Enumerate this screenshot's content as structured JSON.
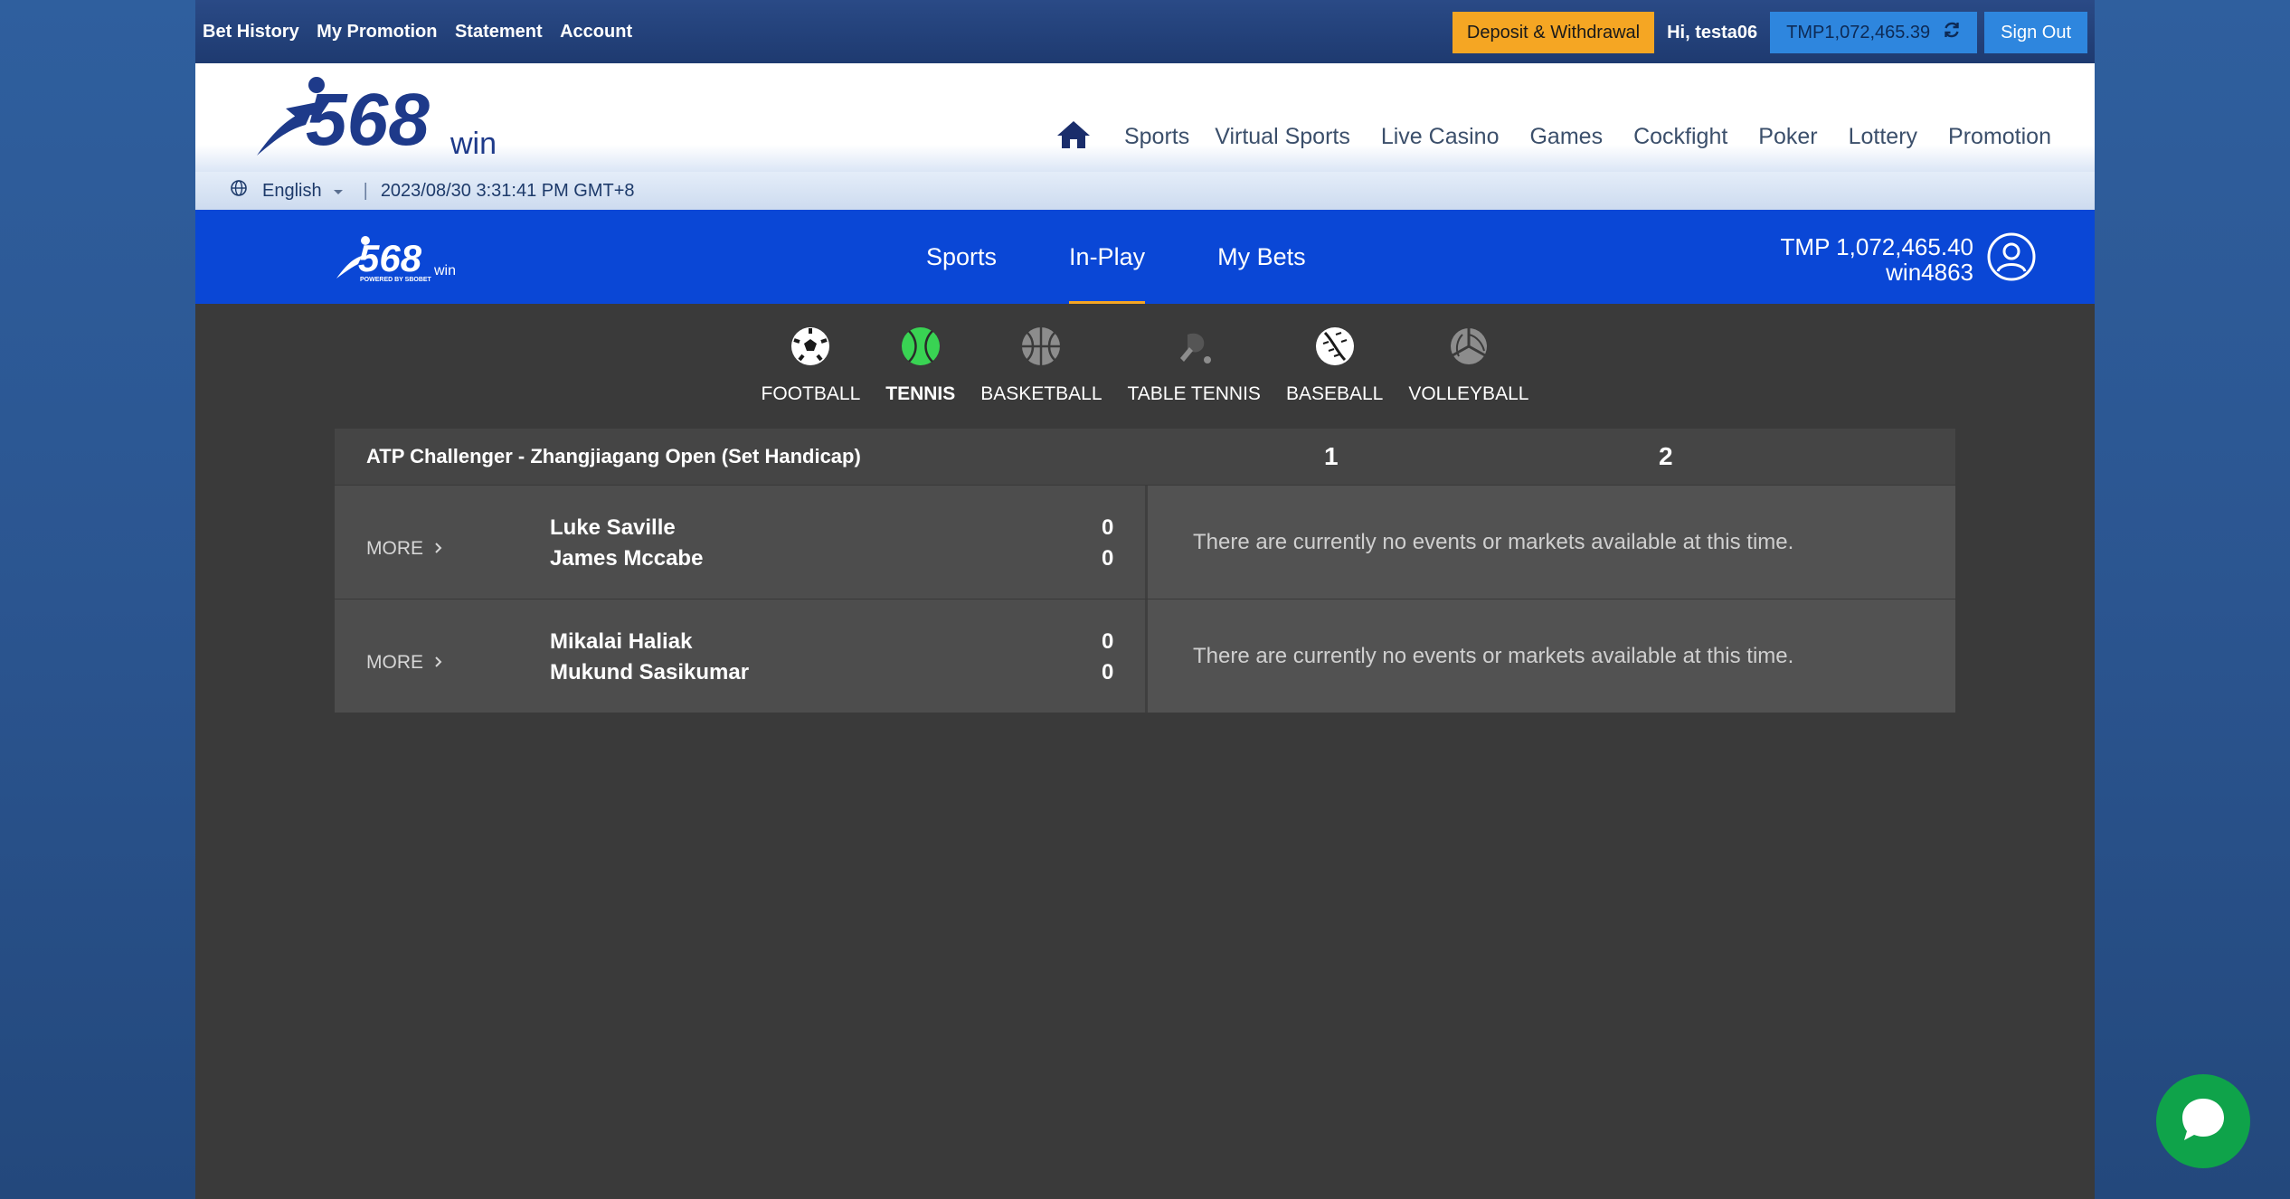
{
  "topbar": {
    "links": [
      "Bet History",
      "My Promotion",
      "Statement",
      "Account"
    ],
    "deposit_label": "Deposit & Withdrawal",
    "greeting": "Hi, testa06",
    "balance": "TMP1,072,465.39",
    "signout_label": "Sign Out"
  },
  "header": {
    "logo_text": "568",
    "logo_suffix": "win",
    "nav": [
      "Sports",
      "Virtual Sports",
      "Live Casino",
      "Games",
      "Cockfight",
      "Poker",
      "Lottery",
      "Promotion"
    ]
  },
  "subbar": {
    "language": "English",
    "datetime": "2023/08/30 3:31:41 PM GMT+8"
  },
  "sportsbook": {
    "logo_text": "568",
    "logo_suffix": "win",
    "logo_tagline": "POWERED BY SBOBET",
    "tabs": [
      "Sports",
      "In-Play",
      "My Bets"
    ],
    "active_tab": "In-Play",
    "balance": "TMP 1,072,465.40",
    "username": "win4863"
  },
  "sports": [
    {
      "label": "FOOTBALL",
      "icon": "football-icon"
    },
    {
      "label": "TENNIS",
      "icon": "tennis-icon"
    },
    {
      "label": "BASKETBALL",
      "icon": "basketball-icon"
    },
    {
      "label": "TABLE TENNIS",
      "icon": "table-tennis-icon"
    },
    {
      "label": "BASEBALL",
      "icon": "baseball-icon"
    },
    {
      "label": "VOLLEYBALL",
      "icon": "volleyball-icon"
    }
  ],
  "active_sport": "TENNIS",
  "league": {
    "name": "ATP Challenger - Zhangjiagang Open (Set Handicap)",
    "col1": "1",
    "col2": "2",
    "events": [
      {
        "more": "MORE",
        "home": "Luke Saville",
        "away": "James Mccabe",
        "home_score": "0",
        "away_score": "0",
        "message": "There are currently no events or markets available at this time."
      },
      {
        "more": "MORE",
        "home": "Mikalai Haliak",
        "away": "Mukund Sasikumar",
        "home_score": "0",
        "away_score": "0",
        "message": "There are currently no events or markets available at this time."
      }
    ]
  },
  "colors": {
    "accent": "#0a47d6",
    "deposit": "#f5a623",
    "tennis_active": "#39d353",
    "chat": "#0fa34a"
  }
}
